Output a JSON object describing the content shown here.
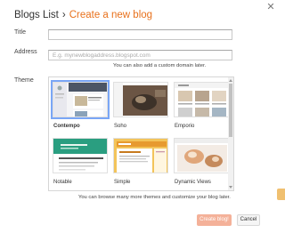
{
  "header": {
    "breadcrumb": "Blogs List",
    "separator": "›",
    "title": "Create a new blog",
    "close_icon": "✕"
  },
  "form": {
    "title_label": "Title",
    "title_value": "",
    "address_label": "Address",
    "address_placeholder": "E.g. mynewblogaddress.blogspot.com",
    "custom_domain_hint": "You can also add a custom domain later.",
    "theme_label": "Theme",
    "themes_hint": "You can browse many more themes and customize your blog later."
  },
  "themes": [
    {
      "name": "Contempo",
      "selected": true
    },
    {
      "name": "Soho",
      "selected": false
    },
    {
      "name": "Emporio",
      "selected": false
    },
    {
      "name": "Notable",
      "selected": false
    },
    {
      "name": "Simple",
      "selected": false
    },
    {
      "name": "Dynamic Views",
      "selected": false
    }
  ],
  "buttons": {
    "create": "Create blog!",
    "cancel": "Cancel"
  },
  "colors": {
    "accent": "#e8711c",
    "create_button": "#f4b199",
    "selected_outline": "#7aa6f6"
  }
}
